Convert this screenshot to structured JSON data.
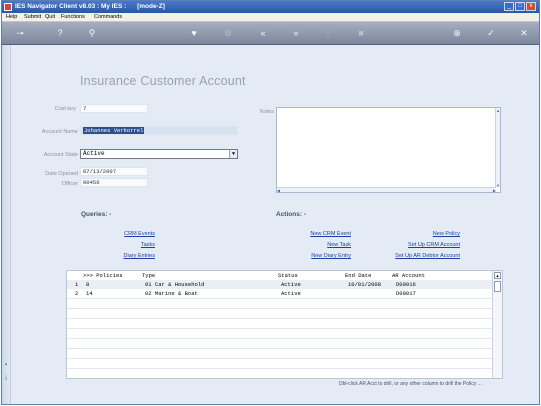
{
  "window": {
    "title": "IES Navigator Client v8.03 : My IES :      [mode-Z]",
    "controls": [
      "_",
      "□",
      "x"
    ]
  },
  "menu": [
    "Help",
    "Submit",
    "Quit",
    "Functions",
    "Commands"
  ],
  "page": {
    "title": "Insurance Customer Account"
  },
  "form": {
    "cust_key_label": "Cust key",
    "cust_key": "7",
    "account_name_label": "Account Name",
    "account_name": "Johannes Verkorrel",
    "account_state_label": "Account State",
    "account_state": "Active",
    "date_opened_label": "Date Opened",
    "date_opened": "07/13/2007",
    "officer_label": "Officer",
    "officer": "00456",
    "notes_label": "Notes"
  },
  "queries": {
    "heading": "Queries: -",
    "links": [
      "CRM Events",
      "Tasks",
      "Diary Entries"
    ]
  },
  "actions": {
    "heading": "Actions: -",
    "links_left": [
      "New CRM Event",
      "New Task",
      "New Diary Entry"
    ],
    "links_right": [
      "New Policy",
      "Set Up CRM Account",
      "Set Up AR Debtor Account"
    ]
  },
  "grid": {
    "columns": [
      ">>> Policies",
      "Type",
      "Status",
      "End Date",
      "AR Account"
    ],
    "rows": [
      {
        "num": "1",
        "policy": "8",
        "type": "01 Car & Household",
        "status": "Active",
        "end_date": "10/01/2008",
        "ar_account": "D00016"
      },
      {
        "num": "2",
        "policy": "14",
        "type": "02 Marine & Boat",
        "status": "Active",
        "end_date": "",
        "ar_account": "D00017"
      }
    ]
  },
  "status_hint": "Dbl-click AR Acct to drill, or any other column to drill the Policy ...",
  "colors": {
    "titlebar": "#2a56a8",
    "link": "#1d3fa8",
    "page_title": "#98a2b3",
    "content_bg": "#e4ebf4"
  }
}
